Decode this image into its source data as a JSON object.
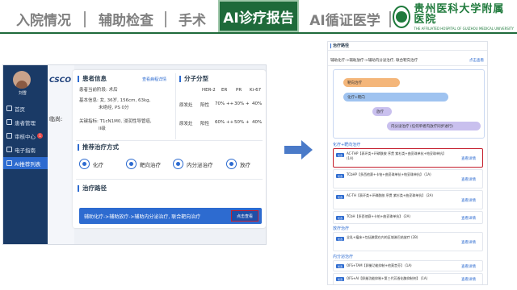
{
  "tabs": [
    {
      "label": "入院情况"
    },
    {
      "label": "辅助检查"
    },
    {
      "label": "手术"
    },
    {
      "label": "AI诊疗报告"
    },
    {
      "label": "AI循证医学"
    }
  ],
  "logo": {
    "name_cn": "贵州医科大学附属医院",
    "name_en": "THE AFFILIATED HOSPITAL OF GUIZHOU MEDICAL UNIVERSITY"
  },
  "colors": {
    "active_tab": "#1e6a3a",
    "primary": "#2d6bd0",
    "highlight": "#c41e2c",
    "nav_bg": "#1a3a66"
  },
  "left_app": {
    "user": "刘雪",
    "brand": "CSCO",
    "behind_text": "临尚:",
    "nav": [
      {
        "label": "首页",
        "icon": "home-icon"
      },
      {
        "label": "患者管理",
        "icon": "user-icon"
      },
      {
        "label": "审核中心",
        "icon": "audit-icon",
        "badge": "1"
      },
      {
        "label": "电子指南",
        "icon": "book-icon"
      },
      {
        "label": "AI推荐列表",
        "icon": "list-icon"
      }
    ],
    "patient_info": {
      "title": "患者信息",
      "link": "查看病程详情",
      "stage": "患者当前阶段: 术后",
      "basic": "基本信息: 女, 36岁, 156cm, 63kg,",
      "basic2": "未绝经, PS 0分",
      "key": "关键指标: T1cN1M0, 浸润性导管癌,",
      "key2": "II级"
    },
    "molecular": {
      "title": "分子分型",
      "headers": [
        "HER-2",
        "ER",
        "PR",
        "Ki-67"
      ],
      "rows": [
        {
          "label": "原发灶",
          "values": [
            "阳性",
            "70% ++",
            "30% +",
            "40%"
          ]
        },
        {
          "label": "原发灶",
          "values": [
            "阳性",
            "60% ++",
            "50% +",
            "40%"
          ]
        }
      ]
    },
    "treatments": {
      "title": "推荐治疗方式",
      "items": [
        {
          "label": "化疗",
          "icon": "chemo-icon"
        },
        {
          "label": "靶向治疗",
          "icon": "target-icon"
        },
        {
          "label": "内分泌治疗",
          "icon": "endocrine-icon"
        },
        {
          "label": "放疗",
          "icon": "radiation-icon"
        }
      ]
    },
    "path": {
      "title": "治疗路径",
      "text": "辅助化疗->辅助放疗->辅助内分泌治疗, 联合靶向治疗",
      "button": "点击查看"
    }
  },
  "right_app": {
    "header": "治疗路径",
    "path_text": "辅助化疗->辅助放疗->辅助内分泌治疗, 联合靶向治疗",
    "path_link": "点击查看",
    "flow": [
      {
        "label": "靶向治疗",
        "color": "#f4b67a"
      },
      {
        "label": "化疗+靶向",
        "color": "#9fc3f0"
      },
      {
        "label": "放疗",
        "color": "#c9c0ee"
      },
      {
        "label": "内分泌治疗 (任何单者内放疗同步进行)",
        "color": "#c9c0ee"
      }
    ],
    "sections": [
      {
        "label": "化疗+靶向治疗",
        "items": [
          {
            "tag": "优选",
            "text": "AC-THP【表环类+环磷酰胺 序贯 紫杉类+曲妥珠单抗+帕妥珠单抗】 (1A)",
            "link": "查看详情",
            "highlight": true
          },
          {
            "tag": "优选",
            "text": "TCbHP【多西他赛+卡铂+曲妥珠单抗+帕妥珠单抗】 (1A)",
            "link": "查看详情",
            "highlight": false
          },
          {
            "tag": "优选",
            "text": "AC-TH【表环类+环磷酰胺 序贯 紫杉类+曲妥珠单抗】 (2A)",
            "link": "查看详情",
            "highlight": false
          },
          {
            "tag": "优选",
            "text": "TCbH【多西他赛+卡铂+曲妥珠单抗】 (2A)",
            "link": "查看详情",
            "highlight": false
          }
        ]
      },
      {
        "label": "放疗治疗",
        "items": [
          {
            "tag": "优选",
            "text": "全乳+瘤床+包括腋窝在内的区域淋巴结放疗 (2B)",
            "link": "查看详情",
            "highlight": false
          }
        ]
      },
      {
        "label": "内分泌治疗",
        "items": [
          {
            "tag": "优选",
            "text": "OFS+TAM【卵巢功能抑制+他莫昔芬】 (1A)",
            "link": "查看详情",
            "highlight": false
          },
          {
            "tag": "优选",
            "text": "OFS+AI【卵巢功能抑制+第三代芳香化酶抑制剂】 (1A)",
            "link": "查看详情",
            "highlight": false
          }
        ]
      }
    ]
  }
}
